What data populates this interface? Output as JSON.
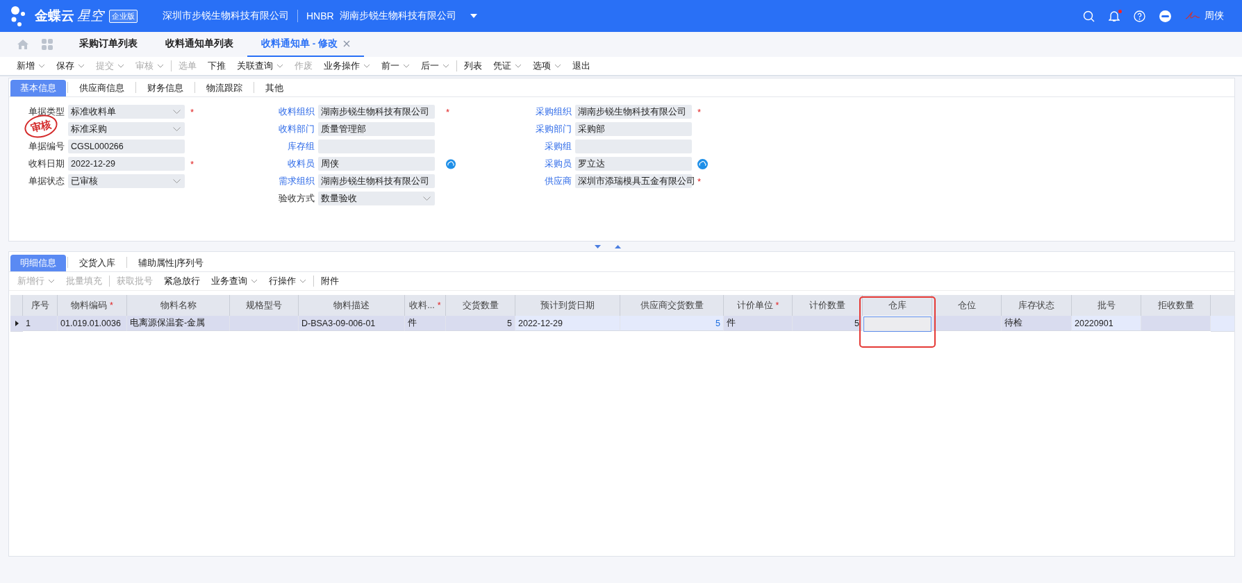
{
  "header": {
    "logo_text": "金蝶云",
    "logo_sub": "星空",
    "edition_badge": "企业版",
    "company": "深圳市步锐生物科技有限公司",
    "org_code": "HNBR",
    "org_name": "湖南步锐生物科技有限公司",
    "user": "周侠",
    "notification_dot": true
  },
  "page_tabs": [
    {
      "label": "采购订单列表",
      "selected": false,
      "closable": false
    },
    {
      "label": "收料通知单列表",
      "selected": false,
      "closable": false
    },
    {
      "label": "收料通知单 - 修改",
      "selected": true,
      "closable": true
    }
  ],
  "toolbar": [
    {
      "kind": "button",
      "label": "新增",
      "dropdown": true,
      "disabled": false
    },
    {
      "kind": "button",
      "label": "保存",
      "dropdown": true,
      "disabled": false
    },
    {
      "kind": "button",
      "label": "提交",
      "dropdown": true,
      "disabled": true
    },
    {
      "kind": "button",
      "label": "审核",
      "dropdown": true,
      "disabled": true
    },
    {
      "kind": "separator"
    },
    {
      "kind": "button",
      "label": "选单",
      "dropdown": false,
      "disabled": true
    },
    {
      "kind": "button",
      "label": "下推",
      "dropdown": false,
      "disabled": false
    },
    {
      "kind": "button",
      "label": "关联查询",
      "dropdown": true,
      "disabled": false
    },
    {
      "kind": "button",
      "label": "作废",
      "dropdown": false,
      "disabled": true
    },
    {
      "kind": "button",
      "label": "业务操作",
      "dropdown": true,
      "disabled": false
    },
    {
      "kind": "button",
      "label": "前一",
      "dropdown": true,
      "disabled": false
    },
    {
      "kind": "button",
      "label": "后一",
      "dropdown": true,
      "disabled": false
    },
    {
      "kind": "separator"
    },
    {
      "kind": "button",
      "label": "列表",
      "dropdown": false,
      "disabled": false
    },
    {
      "kind": "button",
      "label": "凭证",
      "dropdown": true,
      "disabled": false
    },
    {
      "kind": "button",
      "label": "选项",
      "dropdown": true,
      "disabled": false
    },
    {
      "kind": "button",
      "label": "退出",
      "dropdown": false,
      "disabled": false
    }
  ],
  "form_tabs": [
    {
      "label": "基本信息",
      "selected": true
    },
    {
      "label": "供应商信息",
      "selected": false
    },
    {
      "label": "财务信息",
      "selected": false
    },
    {
      "label": "物流跟踪",
      "selected": false
    },
    {
      "label": "其他",
      "selected": false
    }
  ],
  "form": {
    "stamp": "审核",
    "columns": [
      [
        {
          "label": "单据类型",
          "value": "标准收料单",
          "kind": "select",
          "required_mark": "*",
          "linked": false,
          "lookup": false
        },
        {
          "value": "标准采购",
          "kind": "select",
          "lookup": false
        },
        {
          "label": "单据编号",
          "value": "CGSL000266",
          "kind": "text",
          "linked": false,
          "lookup": false
        },
        {
          "label": "收料日期",
          "value": "2022-12-29",
          "kind": "text",
          "required_mark": "*",
          "linked": false,
          "lookup": false
        },
        {
          "label": "单据状态",
          "value": "已审核",
          "kind": "select",
          "linked": false,
          "lookup": false
        }
      ],
      [
        {
          "label": "收料组织",
          "value": "湖南步锐生物科技有限公司",
          "kind": "text",
          "required_mark": "*",
          "linked": true,
          "lookup": false
        },
        {
          "label": "收料部门",
          "value": "质量管理部",
          "kind": "text",
          "linked": true,
          "lookup": false
        },
        {
          "label": "库存组",
          "kind": "text",
          "linked": true,
          "lookup": false
        },
        {
          "label": "收料员",
          "value": "周侠",
          "kind": "text",
          "linked": true,
          "lookup": true
        },
        {
          "label": "需求组织",
          "value": "湖南步锐生物科技有限公司",
          "kind": "text",
          "linked": true,
          "lookup": false
        },
        {
          "label": "验收方式",
          "value": "数量验收",
          "kind": "select",
          "linked": false,
          "lookup": false
        }
      ],
      [
        {
          "label": "采购组织",
          "value": "湖南步锐生物科技有限公司",
          "kind": "text",
          "required_mark": "*",
          "linked": true,
          "lookup": false
        },
        {
          "label": "采购部门",
          "value": "采购部",
          "kind": "text",
          "linked": true,
          "lookup": false
        },
        {
          "label": "采购组",
          "kind": "text",
          "linked": true,
          "lookup": false
        },
        {
          "label": "采购员",
          "value": "罗立达",
          "kind": "text",
          "linked": true,
          "lookup": true
        },
        {
          "label": "供应商",
          "value": "深圳市添瑞模具五金有限公司",
          "kind": "text",
          "required_mark": "*",
          "linked": true,
          "lookup": false
        }
      ]
    ]
  },
  "detail_tabs": [
    {
      "label": "明细信息",
      "selected": true
    },
    {
      "label": "交货入库",
      "selected": false
    },
    {
      "label": "辅助属性|序列号",
      "selected": false
    }
  ],
  "detail_toolbar": [
    {
      "kind": "button",
      "label": "新增行",
      "dropdown": true,
      "disabled": true
    },
    {
      "kind": "button",
      "label": "批量填充",
      "dropdown": false,
      "disabled": true
    },
    {
      "kind": "separator"
    },
    {
      "kind": "button",
      "label": "获取批号",
      "dropdown": false,
      "disabled": true
    },
    {
      "kind": "button",
      "label": "紧急放行",
      "dropdown": false,
      "disabled": false
    },
    {
      "kind": "button",
      "label": "业务查询",
      "dropdown": true,
      "disabled": false
    },
    {
      "kind": "button",
      "label": "行操作",
      "dropdown": true,
      "disabled": false
    },
    {
      "kind": "separator"
    },
    {
      "kind": "button",
      "label": "附件",
      "dropdown": false,
      "disabled": false
    }
  ],
  "table": {
    "columns": [
      {
        "label": "序号",
        "highlighted": false
      },
      {
        "label": "物料编码",
        "required_mark": "*",
        "highlighted": false
      },
      {
        "label": "物料名称",
        "highlighted": false
      },
      {
        "label": "规格型号",
        "highlighted": false
      },
      {
        "label": "物料描述",
        "highlighted": false
      },
      {
        "label": "收料...",
        "required_mark": "*",
        "highlighted": false
      },
      {
        "label": "交货数量",
        "highlighted": false
      },
      {
        "label": "预计到货日期",
        "highlighted": false
      },
      {
        "label": "供应商交货数量",
        "highlighted": false
      },
      {
        "label": "计价单位",
        "required_mark": "*",
        "highlighted": false
      },
      {
        "label": "计价数量",
        "highlighted": false
      },
      {
        "label": "仓库",
        "highlighted": true
      },
      {
        "label": "仓位",
        "highlighted": false
      },
      {
        "label": "库存状态",
        "highlighted": false
      },
      {
        "label": "批号",
        "highlighted": false
      },
      {
        "label": "拒收数量",
        "highlighted": false
      }
    ],
    "rows": [
      {
        "selected": true,
        "cells": [
          {
            "value": "1",
            "editable": false,
            "numeric": false,
            "linked": false,
            "focused": false
          },
          {
            "value": "01.019.01.0036",
            "editable": false,
            "numeric": false,
            "linked": false,
            "focused": false
          },
          {
            "value": "电离源保温套-金属",
            "editable": false,
            "numeric": false,
            "linked": false,
            "focused": false
          },
          {
            "editable": false,
            "focused": false
          },
          {
            "value": "D-BSA3-09-006-01",
            "editable": false,
            "numeric": false,
            "linked": false,
            "focused": false
          },
          {
            "value": "件",
            "editable": false,
            "numeric": false,
            "linked": false,
            "focused": false
          },
          {
            "value": "5",
            "editable": false,
            "numeric": true,
            "linked": false,
            "focused": false
          },
          {
            "value": "2022-12-29",
            "editable": true,
            "numeric": false,
            "linked": false,
            "focused": false
          },
          {
            "value": "5",
            "editable": true,
            "numeric": true,
            "linked": true,
            "focused": false
          },
          {
            "value": "件",
            "editable": false,
            "numeric": false,
            "linked": false,
            "focused": false
          },
          {
            "value": "5",
            "editable": false,
            "numeric": true,
            "linked": false,
            "focused": false
          },
          {
            "editable": true,
            "focused": true
          },
          {
            "editable": false,
            "focused": false
          },
          {
            "value": "待检",
            "editable": false,
            "numeric": false,
            "linked": false,
            "focused": false
          },
          {
            "value": "20220901",
            "editable": true,
            "numeric": false,
            "linked": false,
            "focused": false
          },
          {
            "editable": false,
            "focused": false
          }
        ]
      }
    ]
  }
}
